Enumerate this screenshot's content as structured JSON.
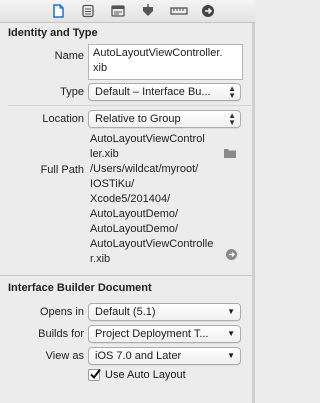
{
  "toolbar": {
    "icons": [
      "file-inspector-icon",
      "quick-help-icon",
      "identity-icon",
      "attributes-icon",
      "size-icon",
      "connections-icon"
    ]
  },
  "identity": {
    "title": "Identity and Type",
    "name_label": "Name",
    "name_value": "AutoLayoutViewController.\nxib",
    "type_label": "Type",
    "type_value": "Default – Interface Bu...",
    "location_label": "Location",
    "location_value": "Relative to Group",
    "relative_path": "AutoLayoutViewControl\nler.xib",
    "full_path_label": "Full Path",
    "full_path_value": "/Users/wildcat/myroot/\nIOSTiKu/\nXcode5/201404/\nAutoLayoutDemo/\nAutoLayoutDemo/\nAutoLayoutViewControlle\nr.xib"
  },
  "ib": {
    "title": "Interface Builder Document",
    "opens_in_label": "Opens in",
    "opens_in_value": "Default (5.1)",
    "builds_for_label": "Builds for",
    "builds_for_value": "Project Deployment T...",
    "view_as_label": "View as",
    "view_as_value": "iOS 7.0 and Later",
    "auto_layout_label": "Use Auto Layout",
    "auto_layout_checked": true
  }
}
